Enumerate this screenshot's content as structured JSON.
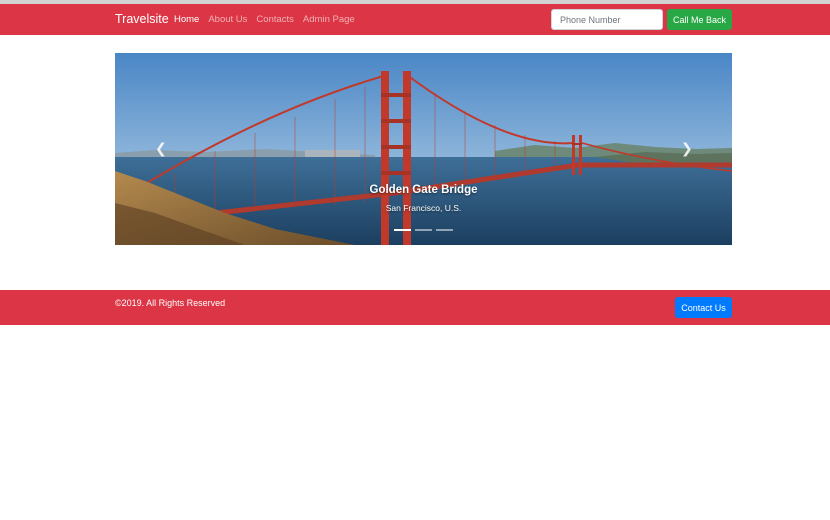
{
  "navbar": {
    "brand": "Travelsite",
    "links": [
      {
        "label": "Home",
        "active": true
      },
      {
        "label": "About Us",
        "active": false
      },
      {
        "label": "Contacts",
        "active": false
      },
      {
        "label": "Admin Page",
        "active": false
      }
    ],
    "phone_placeholder": "Phone Number",
    "call_button": "Call Me Back"
  },
  "carousel": {
    "slide_title": "Golden Gate Bridge",
    "slide_subtitle": "San Francisco, U.S.",
    "prev_icon": "chevron-left-icon",
    "next_icon": "chevron-right-icon",
    "indicator_count": 3,
    "active_index": 0
  },
  "footer": {
    "copyright": "©2019. All Rights Reserved",
    "contact_button": "Contact Us"
  },
  "colors": {
    "brand_red": "#dc3545",
    "success_green": "#28a745",
    "primary_blue": "#007bff"
  }
}
